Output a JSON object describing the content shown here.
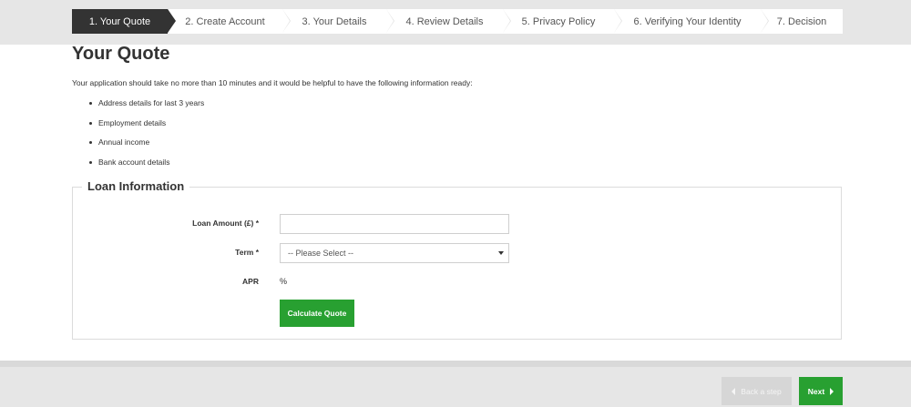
{
  "steps": [
    {
      "label": "1. Your Quote",
      "active": true
    },
    {
      "label": "2. Create Account",
      "active": false
    },
    {
      "label": "3. Your Details",
      "active": false
    },
    {
      "label": "4. Review Details",
      "active": false
    },
    {
      "label": "5. Privacy Policy",
      "active": false
    },
    {
      "label": "6. Verifying Your Identity",
      "active": false
    },
    {
      "label": "7. Decision",
      "active": false
    }
  ],
  "page": {
    "title": "Your Quote",
    "intro": "Your application should take no more than 10 minutes and it would be helpful to have the following information ready:",
    "requirements": [
      "Address details for last 3 years",
      "Employment details",
      "Annual income",
      "Bank account details"
    ]
  },
  "loan": {
    "legend": "Loan Information",
    "amount_label": "Loan Amount (£) *",
    "amount_value": "",
    "term_label": "Term *",
    "term_selected": "-- Please Select --",
    "apr_label": "APR",
    "apr_value": "%",
    "calculate_label": "Calculate Quote"
  },
  "footer": {
    "back_label": "Back a step",
    "next_label": "Next"
  },
  "colors": {
    "accent_green": "#28a031",
    "active_step": "#333333",
    "band_gray": "#e6e6e6"
  }
}
